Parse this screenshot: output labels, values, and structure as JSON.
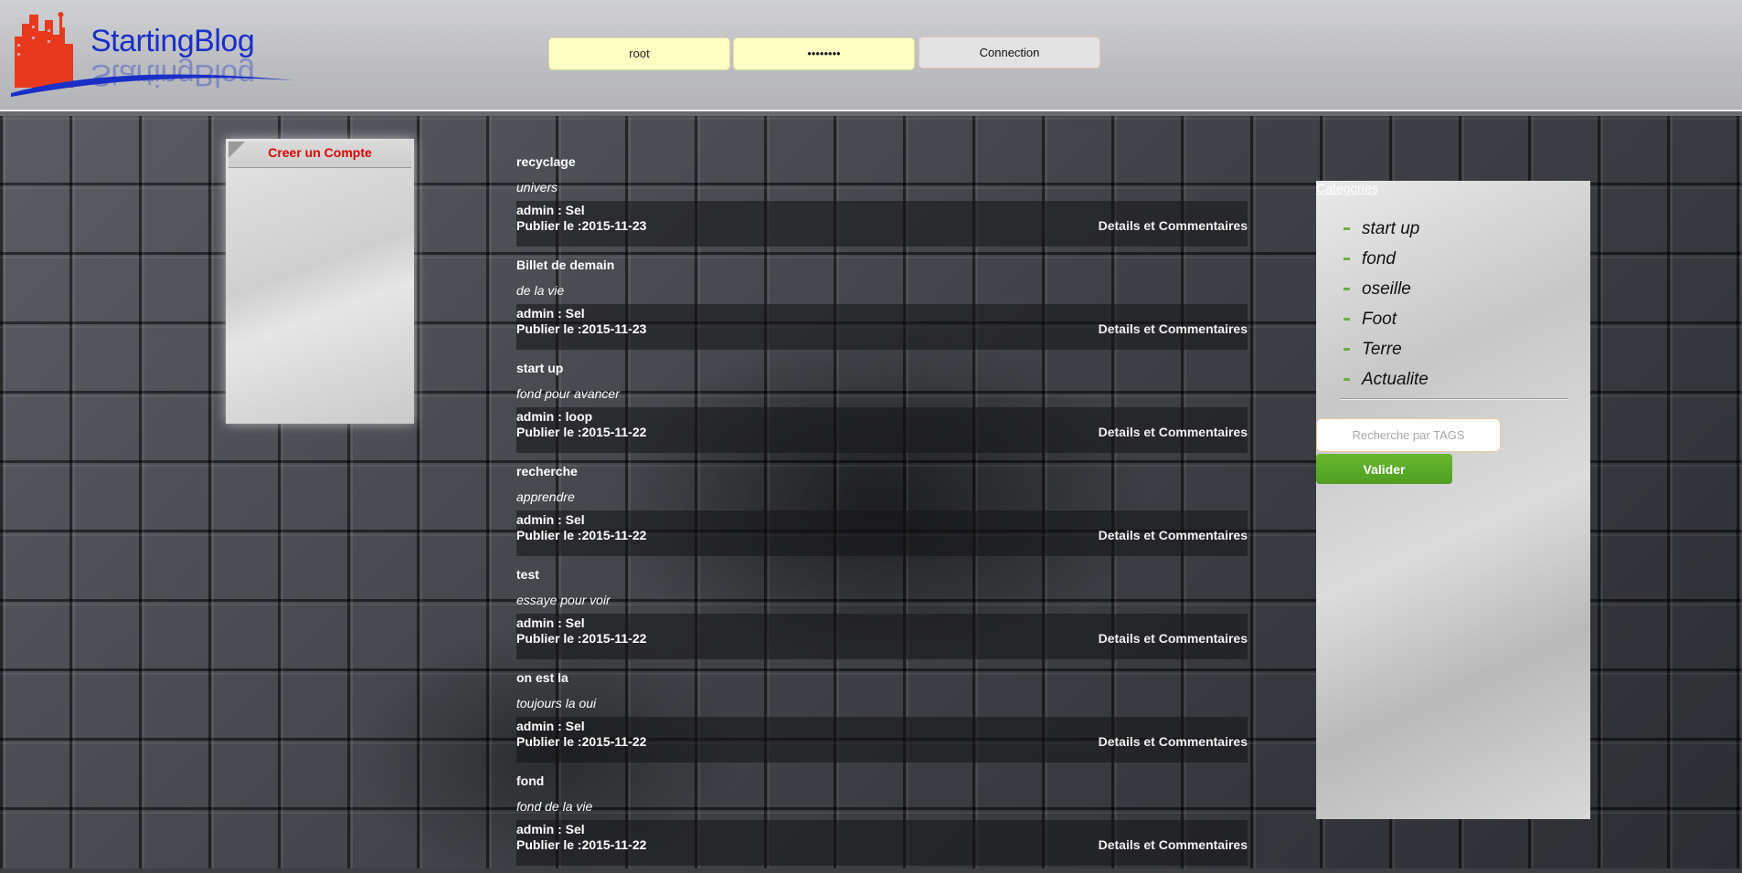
{
  "header": {
    "logo_text": "StartingBlog",
    "login": {
      "username_value": "root",
      "password_value": "••••••••",
      "connect_label": "Connection"
    }
  },
  "left_panel": {
    "create_account_label": "Creer un Compte"
  },
  "posts": [
    {
      "title": "recyclage",
      "subtitle": "univers",
      "author": "admin : Sel",
      "date": "Publier le :2015-11-23",
      "link": "Details et Commentaires"
    },
    {
      "title": "Billet de demain",
      "subtitle": "de la vie",
      "author": "admin : Sel",
      "date": "Publier le :2015-11-23",
      "link": "Details et Commentaires"
    },
    {
      "title": "start up",
      "subtitle": "fond pour avancer",
      "author": "admin : loop",
      "date": "Publier le :2015-11-22",
      "link": "Details et Commentaires"
    },
    {
      "title": "recherche",
      "subtitle": "apprendre",
      "author": "admin : Sel",
      "date": "Publier le :2015-11-22",
      "link": "Details et Commentaires"
    },
    {
      "title": "test",
      "subtitle": "essaye pour voir",
      "author": "admin : Sel",
      "date": "Publier le :2015-11-22",
      "link": "Details et Commentaires"
    },
    {
      "title": "on est la",
      "subtitle": "toujours la oui",
      "author": "admin : Sel",
      "date": "Publier le :2015-11-22",
      "link": "Details et Commentaires"
    },
    {
      "title": "fond",
      "subtitle": "fond de la vie",
      "author": "admin : Sel",
      "date": "Publier le :2015-11-22",
      "link": "Details et Commentaires"
    }
  ],
  "sidebar": {
    "categories_title": "Categories",
    "categories": [
      "start up",
      "fond",
      "oseille",
      "Foot",
      "Terre",
      "Actualite"
    ],
    "search_placeholder": "Recherche par TAGS",
    "validate_label": "Valider"
  },
  "colors": {
    "brand_blue": "#1a2fc7",
    "logo_red": "#e8391e",
    "create_account_red": "#e10000",
    "validate_green": "#5aaa28",
    "login_field_yellow": "#ffffc4"
  }
}
